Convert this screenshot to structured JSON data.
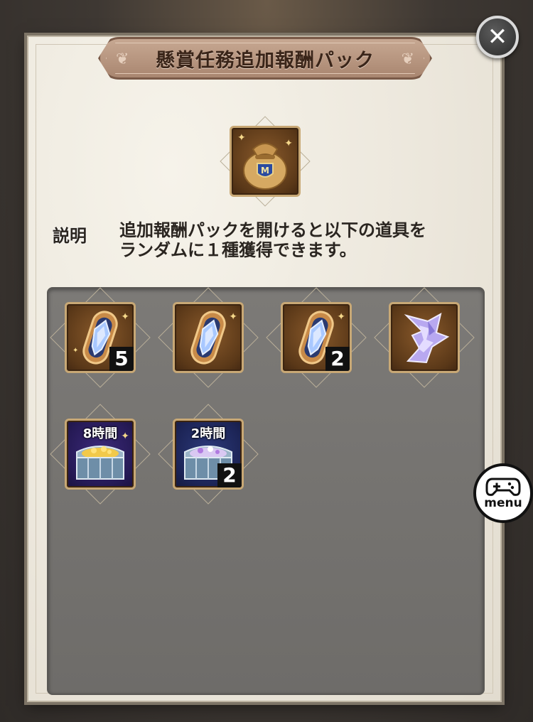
{
  "dialog": {
    "title": "懸賞任務追加報酬パック",
    "close_icon": "close-icon",
    "pack_icon": "reward-bag-icon"
  },
  "description": {
    "label": "説明",
    "line1": "追加報酬パックを開けると以下の道具を",
    "line2": "ランダムに１種獲得できます。"
  },
  "rewards": [
    {
      "icon": "crystal-capsule-icon",
      "count": "5"
    },
    {
      "icon": "crystal-capsule-icon",
      "count": ""
    },
    {
      "icon": "crystal-capsule-icon",
      "count": "2"
    },
    {
      "icon": "crystal-shard-icon",
      "count": ""
    },
    {
      "icon": "gold-chest-icon",
      "duration": "8時間",
      "count": ""
    },
    {
      "icon": "gem-chest-icon",
      "duration": "2時間",
      "count": "2"
    }
  ],
  "overlay": {
    "menu_label": "menu",
    "menu_icon": "gamepad-icon"
  }
}
